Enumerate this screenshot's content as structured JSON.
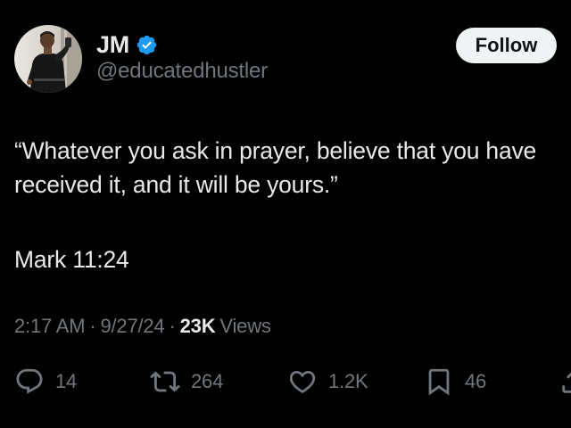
{
  "author": {
    "display_name": "JM",
    "handle": "@educatedhustler",
    "verified_icon": "verified-badge-icon",
    "avatar_icon": "avatar-photo"
  },
  "follow_button": {
    "label": "Follow"
  },
  "tweet": {
    "text": "“Whatever you ask in prayer, believe that you have received it, and it will be yours.”",
    "reference": "Mark 11:24"
  },
  "meta": {
    "time": "2:17 AM",
    "separator": "·",
    "date": "9/27/24",
    "views_count": "23K",
    "views_label": "Views"
  },
  "actions": {
    "replies": {
      "icon": "reply-icon",
      "count": "14"
    },
    "reposts": {
      "icon": "repost-icon",
      "count": "264"
    },
    "likes": {
      "icon": "heart-icon",
      "count": "1.2K"
    },
    "bookmarks": {
      "icon": "bookmark-icon",
      "count": "46"
    },
    "share": {
      "icon": "share-icon"
    }
  },
  "colors": {
    "background": "#000000",
    "text_primary": "#e7e9ea",
    "text_secondary": "#71767b",
    "verified_blue": "#1d9bf0",
    "follow_bg": "#eff3f4"
  }
}
